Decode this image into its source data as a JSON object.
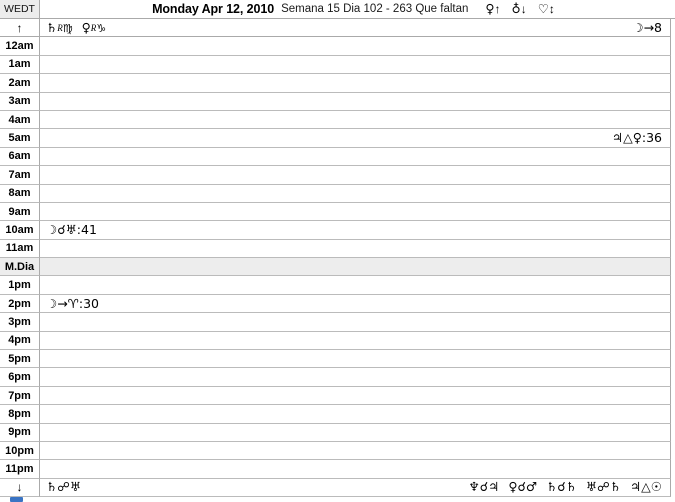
{
  "window": {
    "timezone_label": "WEDT"
  },
  "header": {
    "date": "Monday Apr 12, 2010",
    "subtitle": "Semana 15 Dia 102 - 263 Que faltan",
    "indicators": [
      {
        "name": "sun-rise-indicator",
        "glyph": "♀",
        "arrow": "↑"
      },
      {
        "name": "sun-set-indicator",
        "glyph": "♁",
        "arrow": "↓"
      },
      {
        "name": "moon-transit-indicator",
        "glyph": "♡",
        "arrow": "↕"
      }
    ]
  },
  "rows": [
    {
      "label": "↑",
      "type": "edge-top",
      "left_events": [
        {
          "planet": "♄",
          "retro": "R",
          "sign": "♍"
        },
        {
          "planet": "♀",
          "retro": "R",
          "sign": "♑"
        }
      ],
      "right_events": [
        {
          "text": "☽→8"
        }
      ]
    },
    {
      "label": "12am",
      "type": "hour",
      "left_events": [],
      "right_events": []
    },
    {
      "label": "1am",
      "type": "hour",
      "left_events": [],
      "right_events": []
    },
    {
      "label": "2am",
      "type": "hour",
      "left_events": [],
      "right_events": []
    },
    {
      "label": "3am",
      "type": "hour",
      "left_events": [],
      "right_events": []
    },
    {
      "label": "4am",
      "type": "hour",
      "left_events": [],
      "right_events": []
    },
    {
      "label": "5am",
      "type": "hour",
      "left_events": [],
      "right_events": [
        {
          "text": "♃△♀:36"
        }
      ]
    },
    {
      "label": "6am",
      "type": "hour",
      "left_events": [],
      "right_events": []
    },
    {
      "label": "7am",
      "type": "hour",
      "left_events": [],
      "right_events": []
    },
    {
      "label": "8am",
      "type": "hour",
      "left_events": [],
      "right_events": []
    },
    {
      "label": "9am",
      "type": "hour",
      "left_events": [],
      "right_events": []
    },
    {
      "label": "10am",
      "type": "hour",
      "left_events": [
        {
          "text": "☽☌♅:41"
        }
      ],
      "right_events": []
    },
    {
      "label": "11am",
      "type": "hour",
      "left_events": [],
      "right_events": []
    },
    {
      "label": "M.Dia",
      "type": "noon",
      "left_events": [],
      "right_events": []
    },
    {
      "label": "1pm",
      "type": "hour",
      "left_events": [],
      "right_events": []
    },
    {
      "label": "2pm",
      "type": "hour",
      "left_events": [
        {
          "text": "☽→♈:30"
        }
      ],
      "right_events": []
    },
    {
      "label": "3pm",
      "type": "hour",
      "left_events": [],
      "right_events": []
    },
    {
      "label": "4pm",
      "type": "hour",
      "left_events": [],
      "right_events": []
    },
    {
      "label": "5pm",
      "type": "hour",
      "left_events": [],
      "right_events": []
    },
    {
      "label": "6pm",
      "type": "hour",
      "left_events": [],
      "right_events": []
    },
    {
      "label": "7pm",
      "type": "hour",
      "left_events": [],
      "right_events": []
    },
    {
      "label": "8pm",
      "type": "hour",
      "left_events": [],
      "right_events": []
    },
    {
      "label": "9pm",
      "type": "hour",
      "left_events": [],
      "right_events": []
    },
    {
      "label": "10pm",
      "type": "hour",
      "left_events": [],
      "right_events": []
    },
    {
      "label": "11pm",
      "type": "hour",
      "left_events": [],
      "right_events": []
    },
    {
      "label": "↓",
      "type": "edge-bottom",
      "left_events": [
        {
          "text": "♄☍♅"
        }
      ],
      "right_events": [
        {
          "text": "♆☌♃"
        },
        {
          "text": "♀☌♂"
        },
        {
          "text": "♄☌♄"
        },
        {
          "text": "♅☍♄"
        },
        {
          "text": "♃△☉"
        }
      ]
    }
  ],
  "colors": {
    "grid_line": "#bbbbbb",
    "border": "#aaaaaa",
    "row_highlight": "#ededed",
    "scroll_nub": "#3a74c4"
  }
}
